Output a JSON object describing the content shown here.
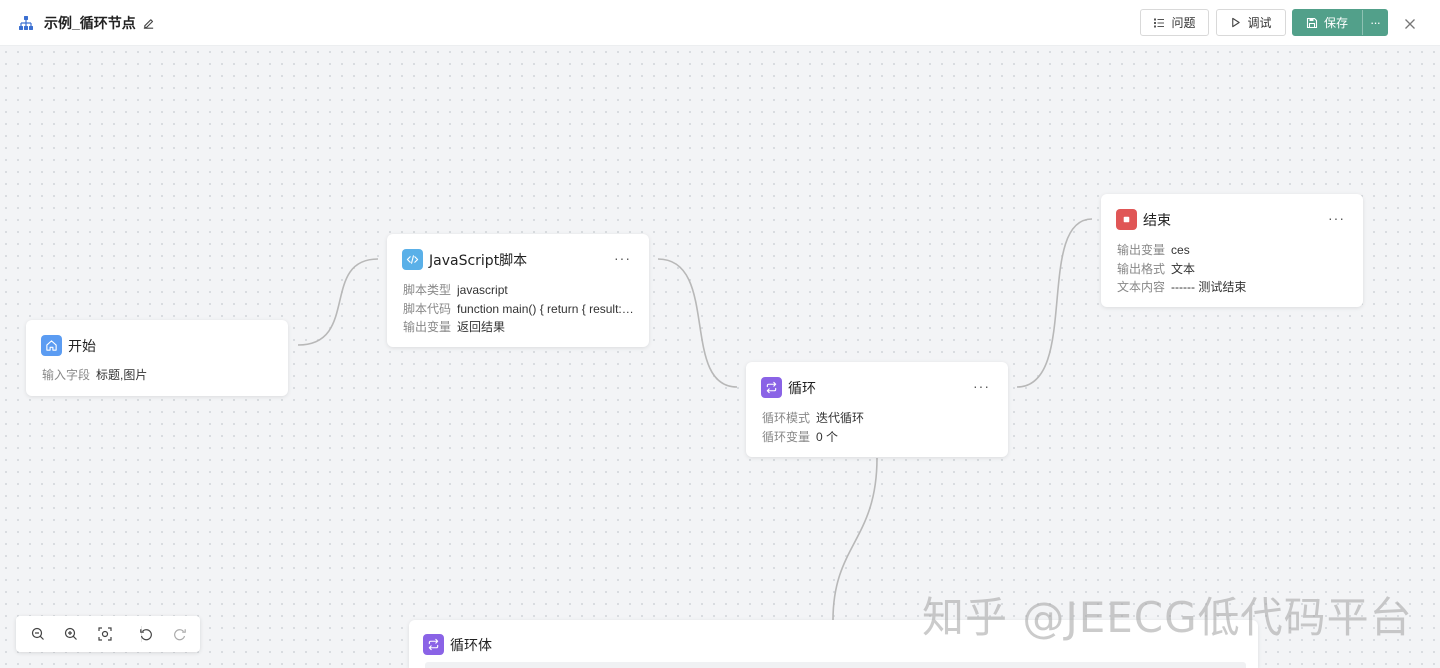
{
  "header": {
    "title": "示例_循环节点",
    "issue_label": "问题",
    "debug_label": "调试",
    "save_label": "保存",
    "more_label": "···"
  },
  "nodes": {
    "start": {
      "title": "开始",
      "rows": [
        {
          "key": "输入字段",
          "value": "标题,图片"
        }
      ]
    },
    "js": {
      "title": "JavaScript脚本",
      "rows": [
        {
          "key": "脚本类型",
          "value": "javascript"
        },
        {
          "key": "脚本代码",
          "value": "function main() { return { result: ..."
        },
        {
          "key": "输出变量",
          "value": "返回结果"
        }
      ]
    },
    "loop": {
      "title": "循环",
      "rows": [
        {
          "key": "循环模式",
          "value": "迭代循环"
        },
        {
          "key": "循环变量",
          "value": "0 个"
        }
      ]
    },
    "end": {
      "title": "结束",
      "rows": [
        {
          "key": "输出变量",
          "value": "ces"
        },
        {
          "key": "输出格式",
          "value": "文本"
        },
        {
          "key": "文本内容",
          "value": "------ 测试结束"
        }
      ]
    },
    "loop_body": {
      "title": "循环体"
    }
  },
  "node_more_label": "···",
  "watermark": "知乎 @JEECG低代码平台",
  "colors": {
    "save_button": "#52a08a",
    "start_icon": "#5b9cf2",
    "js_icon": "#5ab0e8",
    "loop_icon": "#8a63e6",
    "end_icon": "#e05656",
    "edge": "#b8b8b8"
  },
  "icons": {
    "header": "flow-chart-icon",
    "edit": "edit-icon",
    "issue": "list-icon",
    "debug": "play-icon",
    "save": "save-icon",
    "close": "close-icon",
    "start": "home-icon",
    "js": "code-icon",
    "loop": "loop-icon",
    "end": "stop-icon",
    "toolbar": [
      "zoom-out-icon",
      "zoom-in-icon",
      "fit-view-icon",
      "undo-icon",
      "redo-icon"
    ]
  }
}
